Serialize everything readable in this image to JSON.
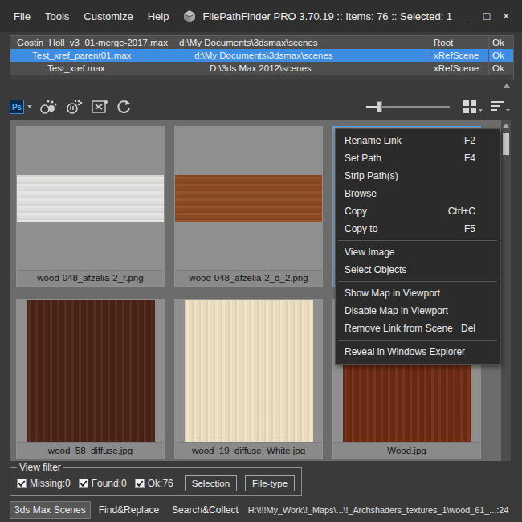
{
  "window": {
    "title": "FilePathFinder PRO 3.70.19 :: Items: 76 :: Selected: 1",
    "controls": [
      "_",
      "□",
      "×"
    ]
  },
  "menu": [
    "File",
    "Tools",
    "Customize",
    "Help"
  ],
  "scenes": [
    {
      "name": "Gostin_Holl_v3_01-merge-2017.max",
      "path": "d:\\My Documents\\3dsmax\\scenes",
      "type": "Root",
      "status": "Ok",
      "depth": 0,
      "selected": false
    },
    {
      "name": "Test_xref_parent01.max",
      "path": "d:\\My Documents\\3dsmax\\scenes",
      "type": "xRefScene",
      "status": "Ok",
      "depth": 1,
      "selected": true
    },
    {
      "name": "Test_xref.max",
      "path": "D:\\3ds Max 2012\\scenes",
      "type": "xRefScene",
      "status": "Ok",
      "depth": 2,
      "selected": false
    }
  ],
  "toolbar": {
    "ps_label": "Ps",
    "zoom": {
      "level": 0.15
    }
  },
  "thumbnails": [
    {
      "label": "wood-048_afzelia-2_r.png",
      "selected": false,
      "kind": "strip",
      "color": "#e4e4e2"
    },
    {
      "label": "wood-048_afzelia-2_d_2.png",
      "selected": false,
      "kind": "strip",
      "color": "#8e4a24"
    },
    {
      "selected": true,
      "kind": "full",
      "color": "#e2c094"
    },
    {
      "label": "wood_58_diffuse.jpg",
      "selected": false,
      "kind": "full",
      "color": "#4b2318"
    },
    {
      "label": "wood_19_diffuse_White.jpg",
      "selected": false,
      "kind": "full",
      "color": "#efe2c4"
    },
    {
      "label": "Wood.jpg",
      "selected": false,
      "kind": "full",
      "color": "#6e2a12"
    }
  ],
  "context_menu": {
    "groups": [
      [
        {
          "label": "Rename Link",
          "shortcut": "F2"
        },
        {
          "label": "Set Path",
          "shortcut": "F4"
        },
        {
          "label": "Strip Path(s)"
        },
        {
          "label": "Browse"
        },
        {
          "label": "Copy",
          "shortcut": "Ctrl+C"
        },
        {
          "label": "Copy to",
          "shortcut": "F5"
        }
      ],
      [
        {
          "label": "View Image"
        },
        {
          "label": "Select Objects"
        }
      ],
      [
        {
          "label": "Show Map in Viewport"
        },
        {
          "label": "Disable Map in Viewport"
        },
        {
          "label": "Remove Link from Scene",
          "shortcut": "Del"
        }
      ],
      [
        {
          "label": "Reveal in Windows Explorer"
        }
      ]
    ]
  },
  "view_filter": {
    "title": "View filter",
    "checks": [
      {
        "label": "Missing:0",
        "checked": true
      },
      {
        "label": "Found:0",
        "checked": true
      },
      {
        "label": "Ok:76",
        "checked": true
      }
    ],
    "buttons": [
      "Selection",
      "File-type"
    ]
  },
  "bottom_tabs": [
    {
      "label": "3ds Max Scenes",
      "selected": true
    },
    {
      "label": "Find&Replace",
      "selected": false
    },
    {
      "label": "Search&Collect",
      "selected": false
    }
  ],
  "status_path": "H:\\!!!My_Work\\!_Maps\\...\\!_Archshaders_textures_1\\wood_61_...:24"
}
